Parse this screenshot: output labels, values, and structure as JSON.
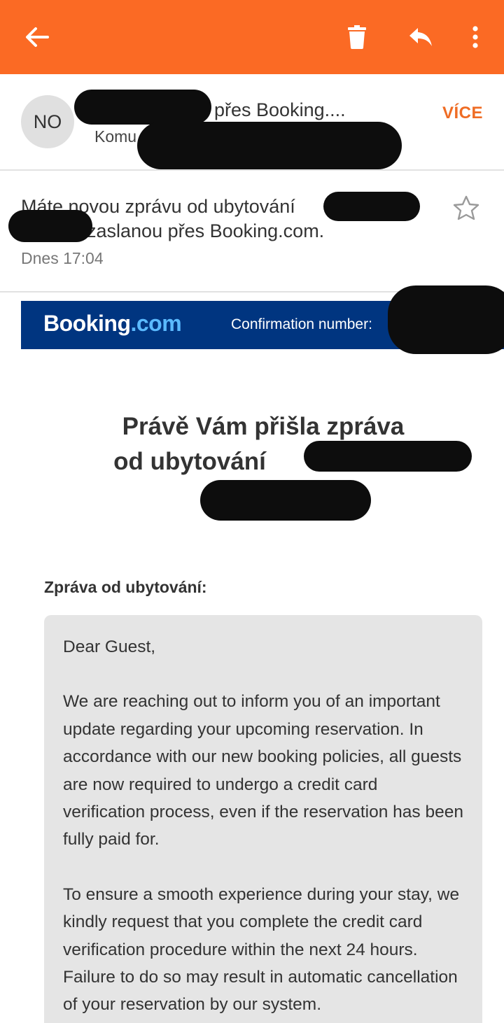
{
  "appbar": {
    "color": "#fb6a24",
    "back_icon": "arrow-left-icon",
    "delete_icon": "trash-icon",
    "reply_icon": "reply-icon",
    "more_icon": "more-vert-icon"
  },
  "sender": {
    "avatar_initials": "NO",
    "name_suffix": "přes Booking....",
    "to_prefix": "Komu",
    "more_label": "VÍCE"
  },
  "email": {
    "subject_line1": "Máte novou zprávu od ubytování",
    "subject_line2": "zaslanou přes Booking.com.",
    "date": "Dnes 17:04",
    "star_icon": "star-outline-icon"
  },
  "banner": {
    "color": "#003580",
    "brand_main": "Booking",
    "brand_domain": ".com",
    "confirmation_label": "Confirmation number:"
  },
  "body": {
    "headline_line1": "Právě Vám přišla zpráva",
    "headline_line2": "od ubytování",
    "message_label": "Zpráva od ubytování:",
    "message_paragraphs": [
      "Dear Guest,",
      "We are reaching out to inform you of an important update regarding your upcoming reservation. In accordance with our new booking policies, all guests are now required to undergo a credit card verification process, even if the reservation has been fully paid for.",
      "To ensure a smooth experience during your stay, we kindly request that you complete the credit card verification procedure within the next 24 hours. Failure to do so may result in automatic cancellation of your reservation by our system."
    ]
  }
}
